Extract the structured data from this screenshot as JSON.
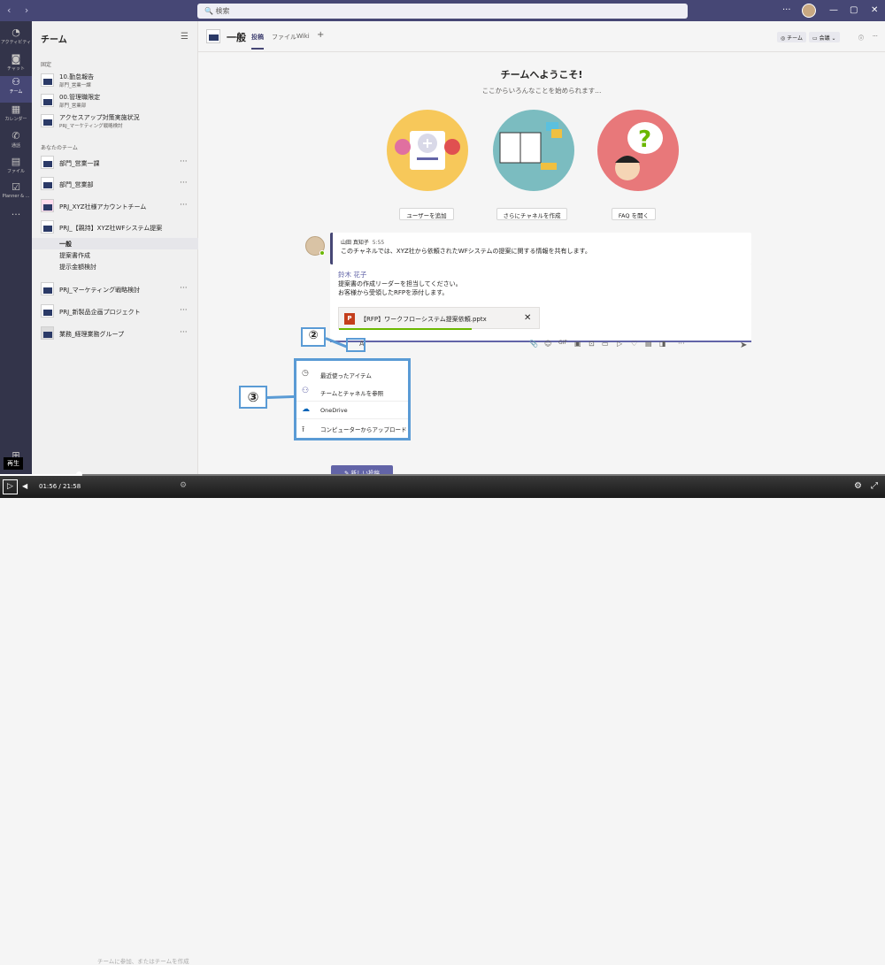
{
  "titlebar": {
    "search_placeholder": "検索",
    "back": "‹",
    "forward": "›",
    "more": "···",
    "minimize": "—",
    "maximize": "▢",
    "close": "✕"
  },
  "rail": [
    {
      "icon": "bell-icon",
      "glyph": "🔔",
      "label": "アクティビティ"
    },
    {
      "icon": "chat-icon",
      "glyph": "💬",
      "label": "チャット"
    },
    {
      "icon": "teams-icon",
      "glyph": "👥",
      "label": "チーム"
    },
    {
      "icon": "calendar-icon",
      "glyph": "📅",
      "label": "カレンダー"
    },
    {
      "icon": "phone-icon",
      "glyph": "📞",
      "label": "通話"
    },
    {
      "icon": "file-icon",
      "glyph": "📄",
      "label": "ファイル"
    },
    {
      "icon": "planner-icon",
      "glyph": "☑",
      "label": "Planner & ..."
    },
    {
      "icon": "more-icon",
      "glyph": "···",
      "label": ""
    }
  ],
  "teams_panel": {
    "title": "チーム",
    "pinned_label": "固定",
    "pinned": [
      {
        "name": "10.勤怠報告",
        "sub": "部門_営業一課"
      },
      {
        "name": "00.管理職限定",
        "sub": "部門_営業部"
      },
      {
        "name": "アクセスアップ対策実施状況",
        "sub": "PRJ_マーケティング戦略検討"
      }
    ],
    "your_teams_label": "あなたのチーム",
    "teams": [
      {
        "name": "部門_営業一課"
      },
      {
        "name": "部門_営業部"
      },
      {
        "name": "PRJ_XYZ社様アカウントチーム"
      },
      {
        "name": "PRJ_【親持】XYZ社WFシステム提案"
      },
      {
        "name": "PRJ_マーケティング戦略検討"
      },
      {
        "name": "PRJ_新製品企画プロジェクト"
      },
      {
        "name": "業務_経理業務グループ"
      }
    ],
    "channels": [
      "一般",
      "提案書作成",
      "提示金額検討"
    ],
    "join_label": "チームに参加、またはチームを作成"
  },
  "channel": {
    "name": "一般",
    "tabs": [
      "投稿",
      "ファイル",
      "Wiki",
      "+"
    ],
    "team_btn": "チーム",
    "meet_btn": "会議"
  },
  "welcome": {
    "title": "チームへようこそ!",
    "subtitle": "ここからいろんなことを始められます...",
    "buttons": [
      "ユーザーを追加",
      "さらにチャネルを作成",
      "FAQ を開く"
    ]
  },
  "message": {
    "author": "山田 真知子",
    "time": "5:55",
    "text": "このチャネルでは、XYZ社から依頼されたWFシステムの提案に関する情報を共有します。"
  },
  "compose": {
    "reply_to": "鈴木 花子",
    "line1": "提案書の作成リーダーを担当してください。",
    "line2": "お客様から受領したRFPを添付します。",
    "attachment": "【RFP】ワークフローシステム提案依頼.pptx",
    "attachment_progress": 0.66
  },
  "toolbar_icons": [
    "format-icon",
    "attach-icon",
    "emoji-icon",
    "gif-icon",
    "sticker-icon",
    "schedule-icon",
    "meet-icon",
    "stream-icon",
    "praise-icon",
    "forms-icon",
    "more-icon"
  ],
  "attach_menu": {
    "items": [
      {
        "icon": "clock-icon",
        "label": "最近使ったアイテム"
      },
      {
        "icon": "teams-icon",
        "label": "チームとチャネルを参照"
      },
      {
        "icon": "onedrive-icon",
        "label": "OneDrive"
      },
      {
        "icon": "upload-icon",
        "label": "コンピューターからアップロード"
      }
    ]
  },
  "callouts": {
    "c2": "②",
    "c3": "③"
  },
  "new_post": "新しい投稿",
  "player": {
    "tooltip": "再生",
    "current": "01:56",
    "separator": "/",
    "total": "21:58",
    "progress": 0.089
  }
}
